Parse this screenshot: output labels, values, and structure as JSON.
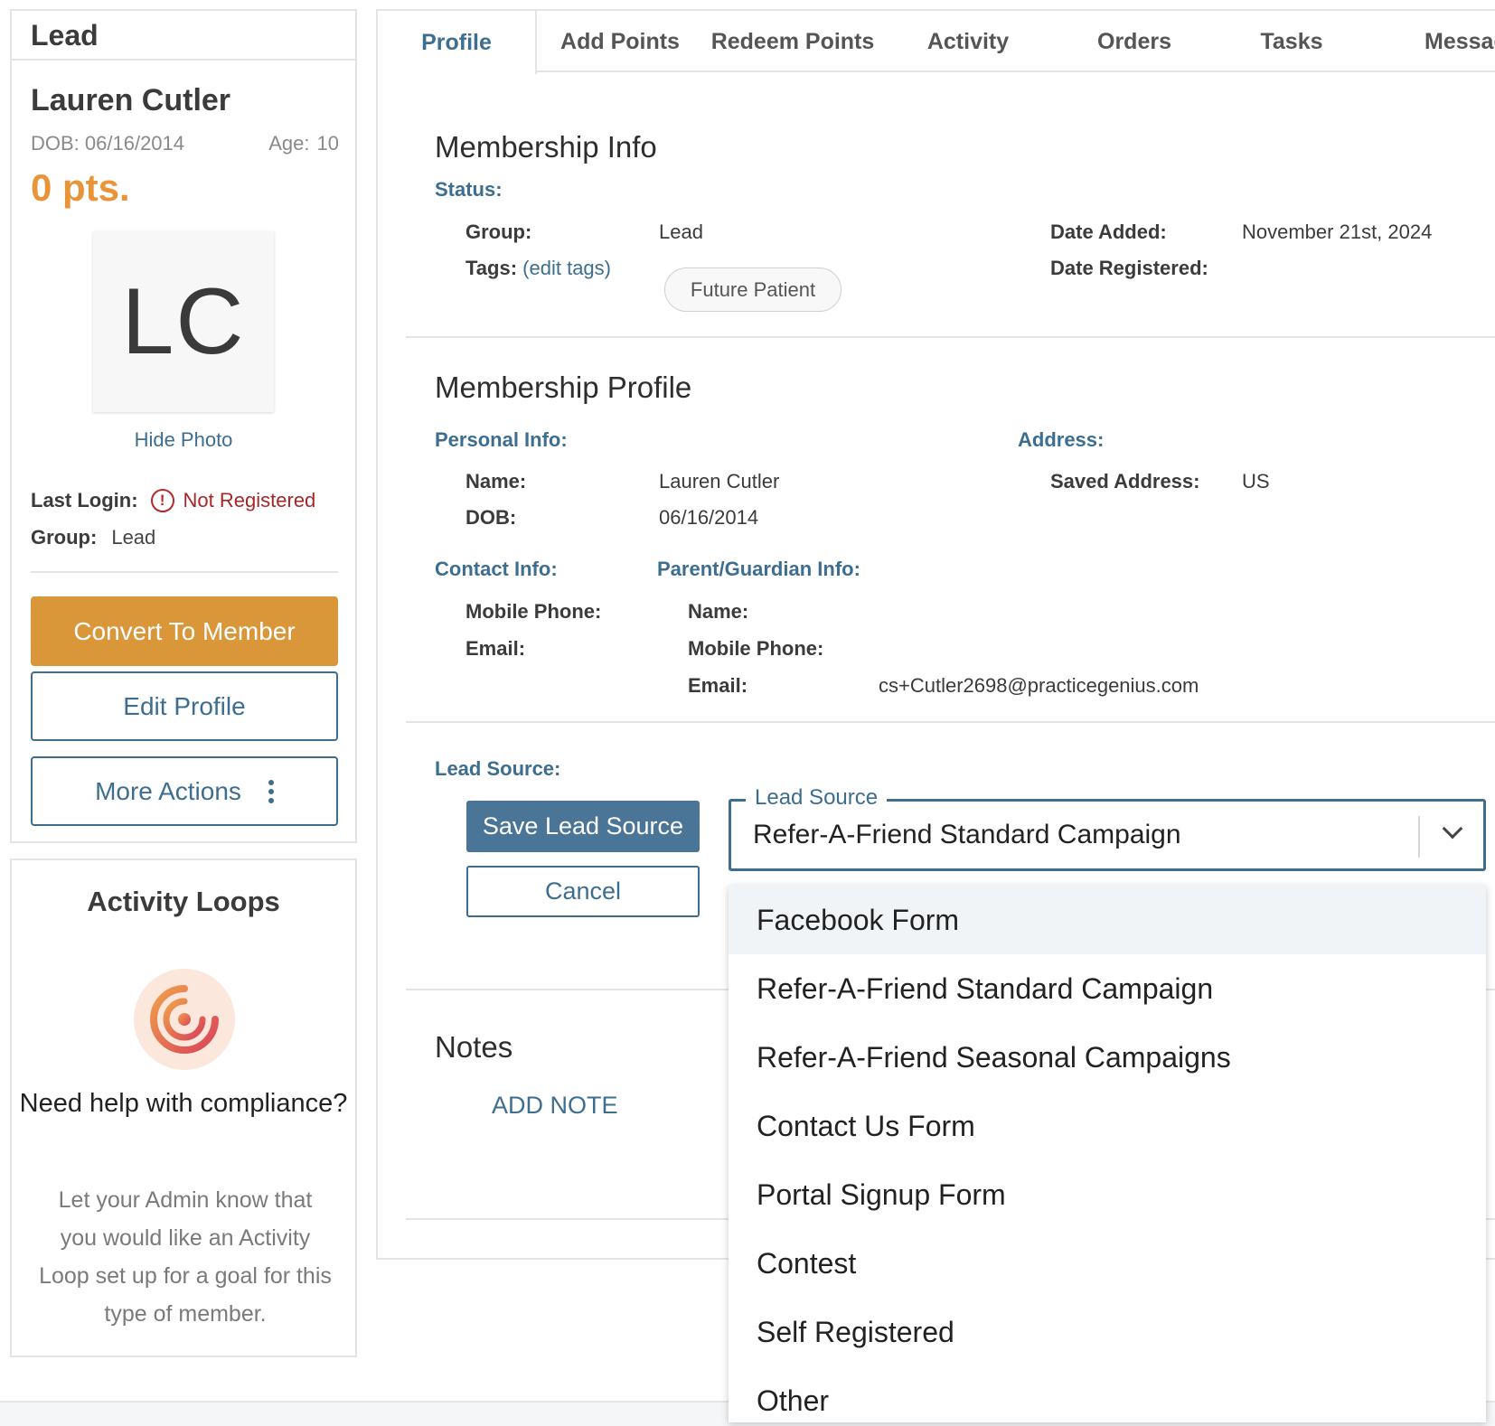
{
  "left": {
    "header_title": "Lead",
    "name": "Lauren Cutler",
    "dob": "DOB: 06/16/2014",
    "age_label": "Age:",
    "age_value": "10",
    "points": "0 pts.",
    "avatar_initials": "LC",
    "hide_photo": "Hide Photo",
    "last_login_label": "Last Login:",
    "last_login_value": "Not Registered",
    "group_label": "Group:",
    "group_value": "Lead",
    "convert_button": "Convert To Member",
    "edit_button": "Edit Profile",
    "more_button": "More Actions"
  },
  "loops": {
    "title": "Activity Loops",
    "question": "Need help with compliance?",
    "description": "Let your Admin know that you would like an Activity Loop set up for a goal for this type of member."
  },
  "tabs": [
    {
      "label": "Profile",
      "active": true
    },
    {
      "label": "Add Points"
    },
    {
      "label": "Redeem Points"
    },
    {
      "label": "Activity"
    },
    {
      "label": "Orders"
    },
    {
      "label": "Tasks"
    },
    {
      "label": "Messag"
    }
  ],
  "membership_info": {
    "title": "Membership Info",
    "status_label": "Status:",
    "group_label": "Group:",
    "group_value": "Lead",
    "tags_label": "Tags:",
    "edit_tags": "(edit tags)",
    "tag_chip": "Future Patient",
    "date_added_label": "Date Added:",
    "date_added_value": "November 21st, 2024",
    "date_registered_label": "Date Registered:"
  },
  "membership_profile": {
    "title": "Membership Profile",
    "personal_label": "Personal Info:",
    "name_label": "Name:",
    "name_value": "Lauren Cutler",
    "dob_label": "DOB:",
    "dob_value": "06/16/2014",
    "address_label": "Address:",
    "saved_address_label": "Saved Address:",
    "saved_address_value": "US",
    "contact_label": "Contact Info:",
    "mobile_label": "Mobile Phone:",
    "email_label": "Email:",
    "guardian_label": "Parent/Guardian Info:",
    "g_name_label": "Name:",
    "g_mobile_label": "Mobile Phone:",
    "g_email_label": "Email:",
    "g_email_value": "cs+Cutler2698@practicegenius.com"
  },
  "lead_source": {
    "label": "Lead Source:",
    "save_button": "Save Lead Source",
    "cancel_button": "Cancel",
    "select_legend": "Lead Source",
    "select_value": "Refer-A-Friend Standard Campaign",
    "options": [
      "Facebook Form",
      "Refer-A-Friend Standard Campaign",
      "Refer-A-Friend Seasonal Campaigns",
      "Contact Us Form",
      "Portal Signup Form",
      "Contest",
      "Self Registered",
      "Other"
    ]
  },
  "notes": {
    "title": "Notes",
    "add_note": "ADD NOTE"
  },
  "colors": {
    "accent": "#3d6e8f",
    "points_orange": "#e8953a",
    "convert_button": "#d9973a",
    "save_button": "#4a7596",
    "error_red": "#a82626"
  }
}
